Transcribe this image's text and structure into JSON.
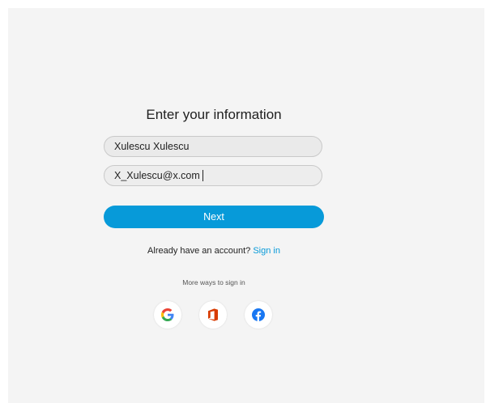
{
  "form": {
    "title": "Enter your information",
    "name_value": "Xulescu Xulescu",
    "email_value": "X_Xulescu@x.com",
    "next_label": "Next"
  },
  "signin": {
    "prompt": "Already have an account?",
    "link_label": "Sign in"
  },
  "alternatives": {
    "label": "More ways to sign in",
    "providers": [
      {
        "name": "google",
        "icon": "google-icon",
        "colors": [
          "#4285F4",
          "#EA4335",
          "#FBBC05",
          "#34A853"
        ]
      },
      {
        "name": "office",
        "icon": "office-icon",
        "color": "#D83B01"
      },
      {
        "name": "facebook",
        "icon": "facebook-icon",
        "color": "#1877F2"
      }
    ]
  },
  "colors": {
    "accent": "#079AD9",
    "background": "#F4F4F4"
  }
}
